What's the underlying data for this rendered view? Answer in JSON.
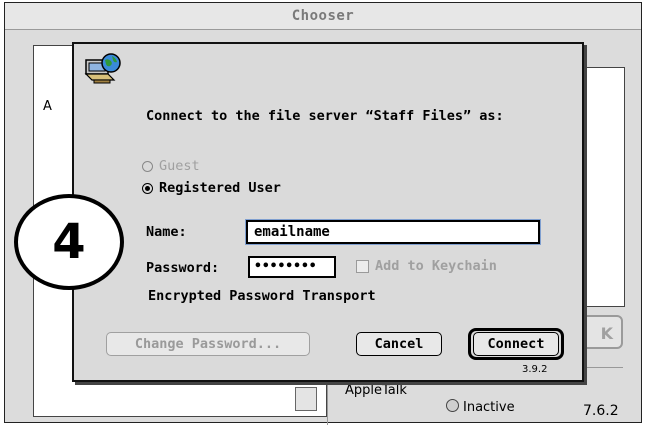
{
  "chooser": {
    "title": "Chooser",
    "left_list_partial_label": "A",
    "ok_partial_label": "K",
    "appletalk_label": "AppleTalk",
    "inactive_label": "Inactive",
    "version": "7.6.2"
  },
  "dialog": {
    "icon": "file-server-globe-icon",
    "prompt": "Connect to the file server “Staff Files” as:",
    "guest_label": "Guest",
    "registered_label": "Registered User",
    "selected_option": "Registered User",
    "name_label": "Name:",
    "name_value": "emailname",
    "password_label": "Password:",
    "password_value": "••••••••",
    "keychain_label": "Add to Keychain",
    "encrypted_label": "Encrypted Password Transport",
    "change_password_label": "Change Password...",
    "cancel_label": "Cancel",
    "connect_label": "Connect",
    "version": "3.9.2"
  },
  "step": {
    "number": "4"
  },
  "colors": {
    "window_bg": "#dcdcdc",
    "dialog_bg": "#dadada",
    "disabled_text": "#a0a0a0",
    "focus_ring": "#7f9fd0"
  }
}
